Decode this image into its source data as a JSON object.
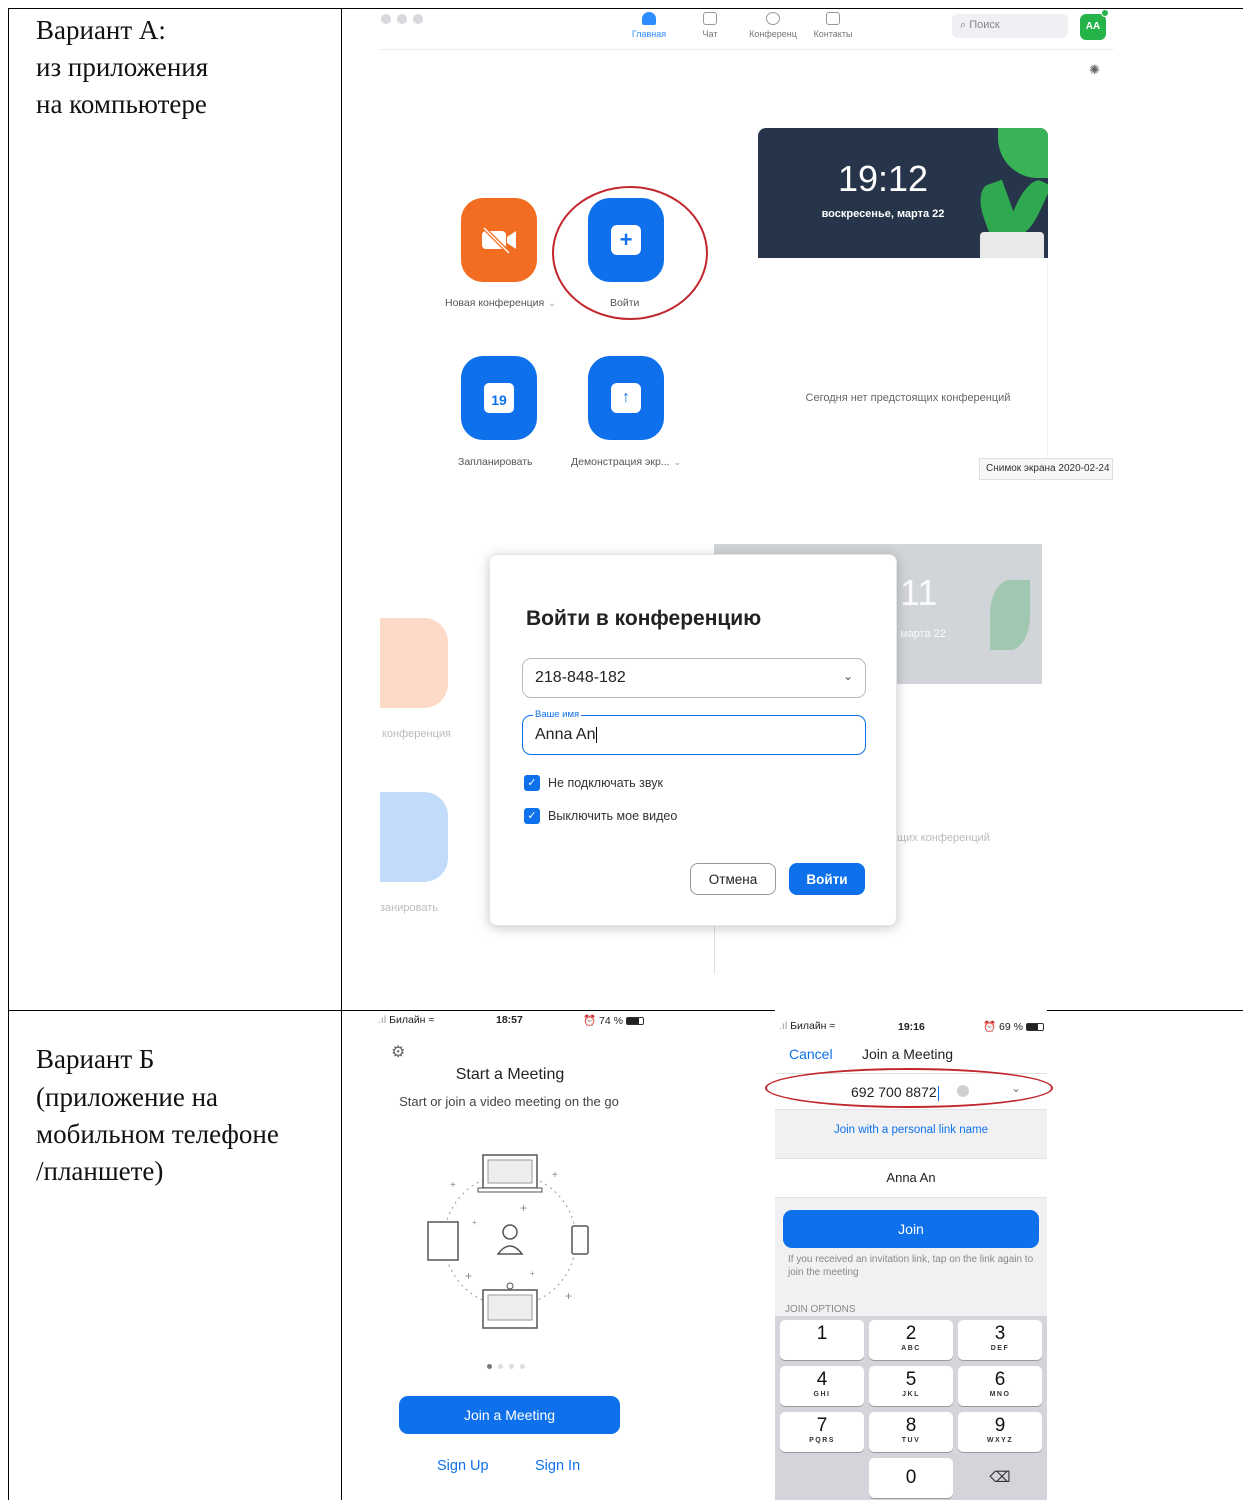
{
  "variant_a": {
    "label_lines": [
      "Вариант А:",
      "из приложения",
      "на компьютере"
    ],
    "nav": {
      "items": [
        {
          "label": "Главная",
          "icon": "home-icon",
          "active": true
        },
        {
          "label": "Чат",
          "icon": "chat-icon"
        },
        {
          "label": "Конференц",
          "icon": "clock-icon"
        },
        {
          "label": "Контакты",
          "icon": "contacts-icon"
        }
      ],
      "search_placeholder": "Поиск",
      "avatar_initials": "AA"
    },
    "actions": {
      "new_meeting": "Новая конференция",
      "join": "Войти",
      "schedule": "Запланировать",
      "schedule_day": "19",
      "share_screen": "Демонстрация экр..."
    },
    "clock": {
      "time": "19:12",
      "date": "воскресенье, марта 22"
    },
    "no_meetings": "Сегодня нет предстоящих конференций",
    "screenshot_tag": "Снимок экрана 2020-02-24",
    "faded_bg": {
      "time_fragment": "11",
      "date_fragment": "марта 22",
      "new_meeting_fragment": "конференция",
      "schedule_fragment": "занировать",
      "no_meetings_fragment": "щих конференций"
    },
    "dialog": {
      "title": "Войти в конференцию",
      "meeting_id": "218-848-182",
      "name_legend": "Ваше имя",
      "name_value": "Anna An",
      "mute_audio": "Не подключать звук",
      "turn_off_video": "Выключить мое видео",
      "cancel": "Отмена",
      "join": "Войти"
    },
    "colors": {
      "accent": "#0e71eb",
      "orange": "#f26d21",
      "highlight_oval": "#c1272d",
      "avatar": "#26b34a"
    }
  },
  "variant_b": {
    "label_lines": [
      "Вариант Б",
      "(приложение на",
      "мобильном телефоне",
      "/планшете)"
    ],
    "phone1": {
      "carrier": "Билайн",
      "time": "18:57",
      "battery": "74 %",
      "title": "Start a Meeting",
      "subtitle": "Start or join a video meeting on the go",
      "join_button": "Join a Meeting",
      "sign_up": "Sign Up",
      "sign_in": "Sign In"
    },
    "phone2": {
      "carrier": "Билайн",
      "time": "19:16",
      "battery": "69 %",
      "cancel": "Cancel",
      "title": "Join a Meeting",
      "meeting_id": "692 700 8872",
      "personal_link": "Join with a personal link name",
      "name": "Anna An",
      "join_button": "Join",
      "hint": "If you received an invitation link, tap on the link again to join the meeting",
      "join_options": "JOIN OPTIONS",
      "keypad": [
        {
          "num": "1",
          "letters": ""
        },
        {
          "num": "2",
          "letters": "ABC"
        },
        {
          "num": "3",
          "letters": "DEF"
        },
        {
          "num": "4",
          "letters": "GHI"
        },
        {
          "num": "5",
          "letters": "JKL"
        },
        {
          "num": "6",
          "letters": "MNO"
        },
        {
          "num": "7",
          "letters": "PQRS"
        },
        {
          "num": "8",
          "letters": "TUV"
        },
        {
          "num": "9",
          "letters": "WXYZ"
        },
        {
          "num": "0",
          "letters": ""
        }
      ]
    }
  }
}
